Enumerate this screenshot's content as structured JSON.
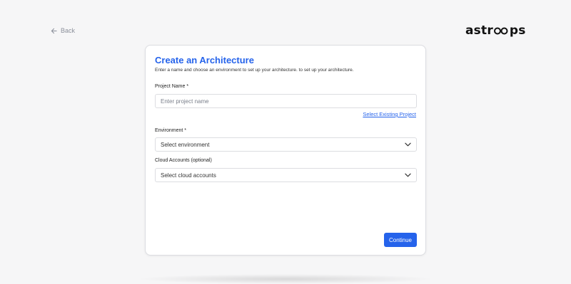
{
  "nav": {
    "back_label": "Back"
  },
  "brand": {
    "logo_part1": "astr",
    "logo_part2": "ps",
    "color": "#111111"
  },
  "form": {
    "title": "Create an Architecture",
    "subtitle": "Enter a name and choose an environment to set up your architecture. to set up your architecture.",
    "project_name": {
      "label": "Project Name",
      "required_mark": "*",
      "placeholder": "Enter project name",
      "value": ""
    },
    "select_existing_link": "Select Existing Project",
    "environment": {
      "label": "Environment",
      "required_mark": "*",
      "value": "Select environment"
    },
    "cloud_accounts": {
      "label": "Cloud Accounts (optional)",
      "value": "Select cloud accounts"
    },
    "continue_label": "Continue"
  },
  "colors": {
    "accent": "#2563eb",
    "background": "#f6f6f7",
    "card": "#ffffff",
    "border": "#dcdde1"
  },
  "icons": {
    "back": "arrow-left-icon",
    "dropdown": "chevron-down-icon"
  }
}
